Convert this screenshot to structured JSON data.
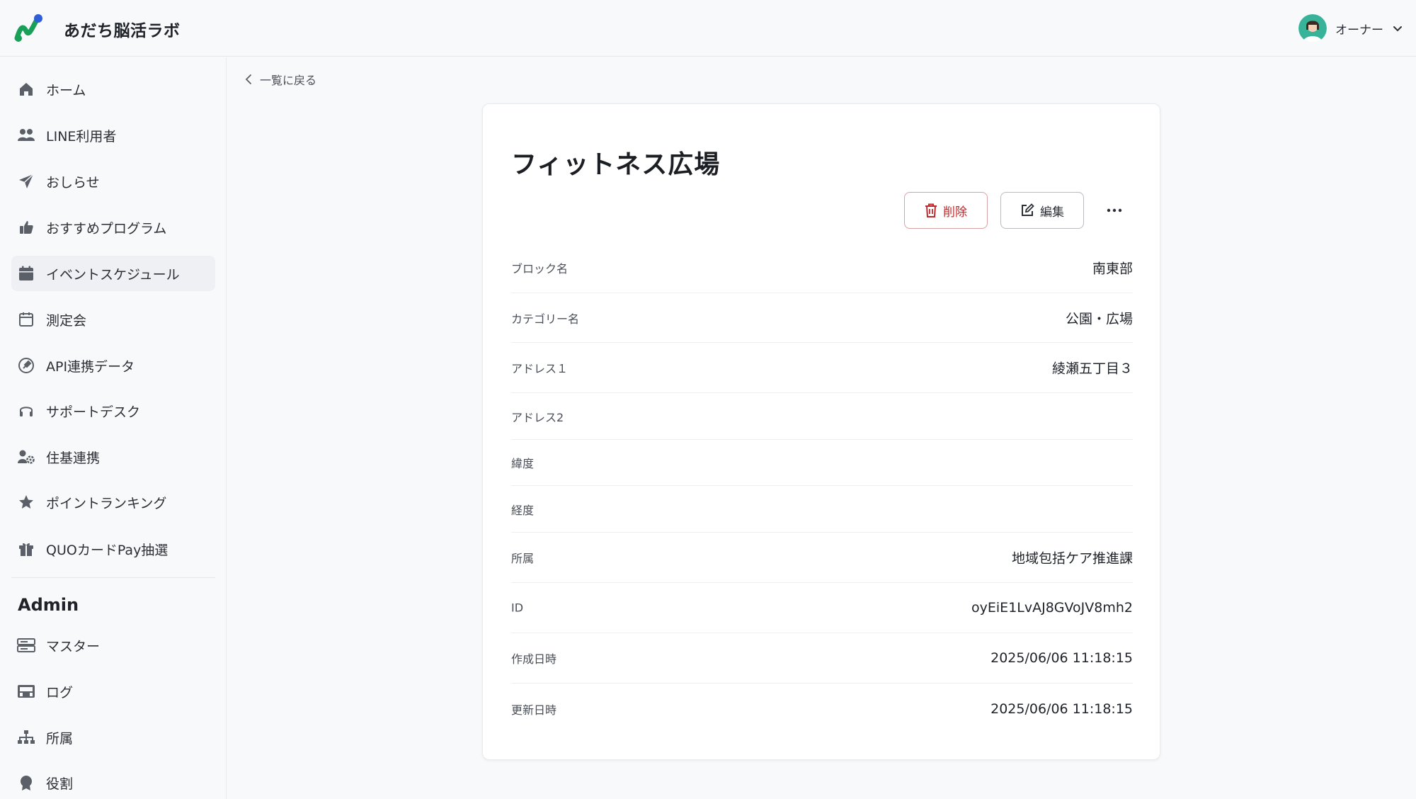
{
  "header": {
    "app_title": "あだち脳活ラボ",
    "user_name": "オーナー"
  },
  "sidebar": {
    "items": [
      {
        "label": "ホーム",
        "icon": "home-icon"
      },
      {
        "label": "LINE利用者",
        "icon": "users-icon"
      },
      {
        "label": "おしらせ",
        "icon": "send-icon"
      },
      {
        "label": "おすすめプログラム",
        "icon": "thumbs-up-icon"
      },
      {
        "label": "イベントスケジュール",
        "icon": "calendar-icon"
      },
      {
        "label": "測定会",
        "icon": "calendar-outline-icon"
      },
      {
        "label": "API連携データ",
        "icon": "plug-icon"
      },
      {
        "label": "サポートデスク",
        "icon": "headset-icon"
      },
      {
        "label": "住基連携",
        "icon": "user-gear-icon"
      },
      {
        "label": "ポイントランキング",
        "icon": "star-icon"
      },
      {
        "label": "QUOカードPay抽選",
        "icon": "gift-icon"
      }
    ],
    "admin_title": "Admin",
    "admin_items": [
      {
        "label": "マスター",
        "icon": "server-icon"
      },
      {
        "label": "ログ",
        "icon": "log-icon"
      },
      {
        "label": "所属",
        "icon": "org-chart-icon"
      },
      {
        "label": "役割",
        "icon": "badge-icon"
      }
    ]
  },
  "main": {
    "back_label": "一覧に戻る",
    "title": "フィットネス広場",
    "delete_label": "削除",
    "edit_label": "編集",
    "rows": [
      {
        "key": "ブロック名",
        "value": "南東部"
      },
      {
        "key": "カテゴリー名",
        "value": "公園・広場"
      },
      {
        "key": "アドレス１",
        "value": "綾瀬五丁目３"
      },
      {
        "key": "アドレス2",
        "value": ""
      },
      {
        "key": "緯度",
        "value": ""
      },
      {
        "key": "経度",
        "value": ""
      },
      {
        "key": "所属",
        "value": "地域包括ケア推進課"
      },
      {
        "key": "ID",
        "value": "oyEiE1LvAJ8GVoJV8mh2"
      },
      {
        "key": "作成日時",
        "value": "2025/06/06 11:18:15"
      },
      {
        "key": "更新日時",
        "value": "2025/06/06 11:18:15"
      }
    ]
  },
  "colors": {
    "delete": "#c0292b",
    "logo_blue": "#2f5fd6",
    "logo_green": "#18a058"
  }
}
